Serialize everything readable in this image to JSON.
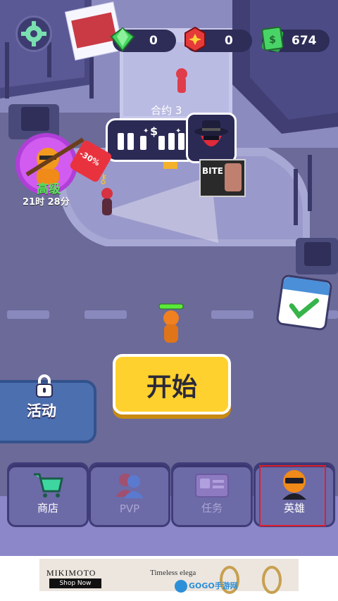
{
  "hud": {
    "gems": "0",
    "tokens": "0",
    "cash": "674",
    "settings_icon": "gear-icon"
  },
  "contract": {
    "title": "合约 3",
    "reward_icon": "dollar-icon"
  },
  "tier": {
    "label": "高级",
    "timer": "21时 28分",
    "discount": "-30%"
  },
  "billboard": "BITE",
  "start_button": "开始",
  "activity_button": "活动",
  "tabs": [
    {
      "label": "商店",
      "icon": "shopping-cart-icon",
      "state": "active"
    },
    {
      "label": "PVP",
      "icon": "users-icon",
      "state": "disabled"
    },
    {
      "label": "任务",
      "icon": "task-card-icon",
      "state": "disabled"
    },
    {
      "label": "英雄",
      "icon": "hero-ninja-icon",
      "state": "highlighted"
    }
  ],
  "ad": {
    "brand": "MIKIMOTO",
    "cta": "Shop Now",
    "tagline": "Timeless elega",
    "watermark": "GOGO手游网"
  },
  "colors": {
    "accent_yellow": "#ffd12e",
    "highlight_red": "#e01e2c",
    "panel_blue": "#4c6fb0"
  }
}
